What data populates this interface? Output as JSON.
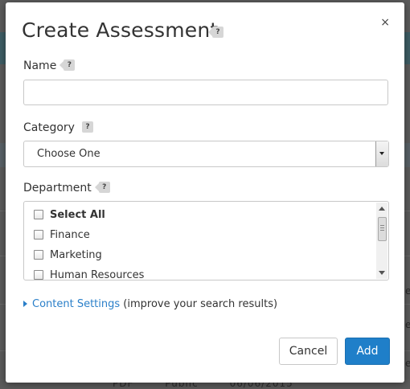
{
  "modal": {
    "title": "Create Assessment",
    "close_glyph": "×",
    "help_glyph": "?"
  },
  "name_field": {
    "label": "Name",
    "value": "",
    "placeholder": ""
  },
  "category_field": {
    "label": "Category",
    "selected": "Choose One"
  },
  "department_field": {
    "label": "Department",
    "items": [
      {
        "label": "Select All",
        "checked": false
      },
      {
        "label": "Finance",
        "checked": false
      },
      {
        "label": "Marketing",
        "checked": false
      },
      {
        "label": "Human Resources",
        "checked": false
      }
    ]
  },
  "content_settings": {
    "link_text": "Content Settings",
    "hint_text": "(improve your search results)"
  },
  "buttons": {
    "cancel": "Cancel",
    "add": "Add"
  },
  "background": {
    "edge_char": "e",
    "bottom_row": [
      "PDF",
      "Public",
      "06/06/2015"
    ]
  },
  "colors": {
    "accent": "#1f7fc9",
    "link": "#2a7fc9",
    "backdrop": "#5c5c5c"
  },
  "icons": {
    "close": "close-icon",
    "help": "help-icon",
    "expand": "caret-right-icon",
    "select": "chevron-down-icon"
  }
}
